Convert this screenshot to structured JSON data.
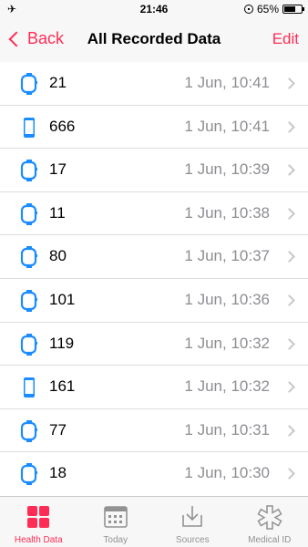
{
  "status_bar": {
    "time": "21:46",
    "battery": "65%",
    "battery_level": 0.65
  },
  "nav": {
    "back_label": "Back",
    "title": "All Recorded Data",
    "edit_label": "Edit"
  },
  "colors": {
    "accent": "#ff2d55",
    "device_blue": "#1a8cff",
    "secondary_text": "#8e8e93"
  },
  "rows": [
    {
      "value": "21",
      "time": "1 Jun, 10:41",
      "device": "watch-icon"
    },
    {
      "value": "666",
      "time": "1 Jun, 10:41",
      "device": "phone-icon"
    },
    {
      "value": "17",
      "time": "1 Jun, 10:39",
      "device": "watch-icon"
    },
    {
      "value": "11",
      "time": "1 Jun, 10:38",
      "device": "watch-icon"
    },
    {
      "value": "80",
      "time": "1 Jun, 10:37",
      "device": "watch-icon"
    },
    {
      "value": "101",
      "time": "1 Jun, 10:36",
      "device": "watch-icon"
    },
    {
      "value": "119",
      "time": "1 Jun, 10:32",
      "device": "watch-icon"
    },
    {
      "value": "161",
      "time": "1 Jun, 10:32",
      "device": "phone-icon"
    },
    {
      "value": "77",
      "time": "1 Jun, 10:31",
      "device": "watch-icon"
    },
    {
      "value": "18",
      "time": "1 Jun, 10:30",
      "device": "watch-icon"
    }
  ],
  "tabs": [
    {
      "label": "Health Data",
      "icon": "health-data-icon",
      "active": true
    },
    {
      "label": "Today",
      "icon": "calendar-icon",
      "active": false
    },
    {
      "label": "Sources",
      "icon": "download-icon",
      "active": false
    },
    {
      "label": "Medical ID",
      "icon": "medical-id-icon",
      "active": false
    }
  ]
}
